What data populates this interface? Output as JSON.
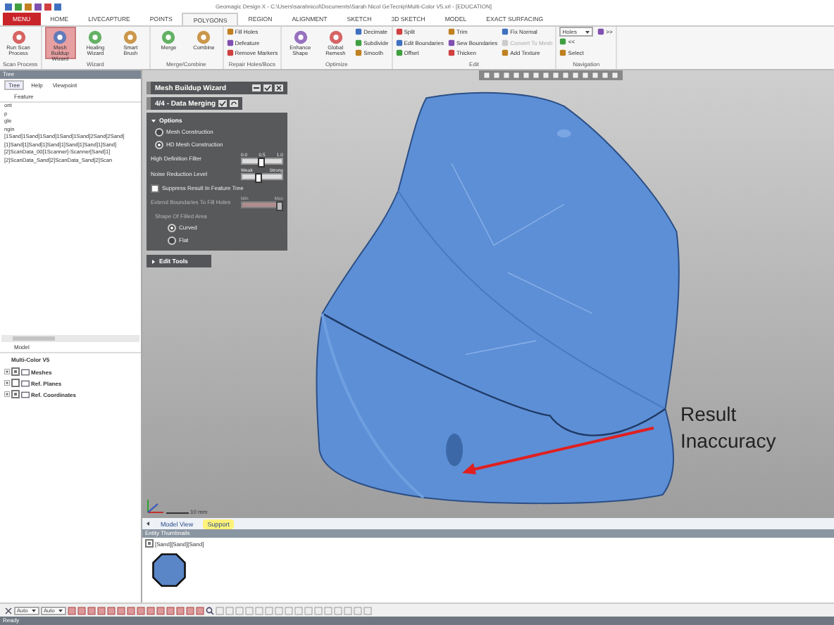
{
  "window": {
    "title": "Geomagic Design X - C:\\Users\\sarahnicol\\Documents\\Sarah Nicol GeTecnip\\Multi-Color V5.xrl - [EDUCATION]"
  },
  "ribbon_tabs": [
    {
      "label": "MENU",
      "kind": "menu",
      "selected": false
    },
    {
      "label": "HOME",
      "kind": "tab",
      "selected": false
    },
    {
      "label": "LIVECAPTURE",
      "kind": "tab",
      "selected": false
    },
    {
      "label": "POINTS",
      "kind": "tab",
      "selected": false
    },
    {
      "label": "POLYGONS",
      "kind": "tab",
      "selected": true
    },
    {
      "label": "REGION",
      "kind": "tab",
      "selected": false
    },
    {
      "label": "ALIGNMENT",
      "kind": "tab",
      "selected": false
    },
    {
      "label": "SKETCH",
      "kind": "tab",
      "selected": false
    },
    {
      "label": "3D SKETCH",
      "kind": "tab",
      "selected": false
    },
    {
      "label": "MODEL",
      "kind": "tab",
      "selected": false
    },
    {
      "label": "EXACT SURFACING",
      "kind": "tab",
      "selected": false
    }
  ],
  "ribbon_groups": [
    {
      "label": "Scan Process",
      "buttons": [
        {
          "kind": "large",
          "label": "Run Scan Process",
          "selected": false
        }
      ]
    },
    {
      "label": "Wizard",
      "buttons": [
        {
          "kind": "large",
          "label": "Mesh Buildup Wizard",
          "selected": true
        },
        {
          "kind": "large",
          "label": "Healing Wizard",
          "selected": false
        },
        {
          "kind": "large",
          "label": "Smart Brush",
          "selected": false
        }
      ]
    },
    {
      "label": "Merge/Combine",
      "buttons": [
        {
          "kind": "large",
          "label": "Merge",
          "selected": false
        },
        {
          "kind": "large",
          "label": "Combine",
          "selected": false
        }
      ]
    },
    {
      "label": "Repair Holes/Bocs",
      "buttons": [
        {
          "kind": "small",
          "label": "Fill Holes",
          "disabled": false
        },
        {
          "kind": "small",
          "label": "Defeature",
          "disabled": false
        },
        {
          "kind": "small",
          "label": "Remove Markers",
          "disabled": false
        }
      ]
    },
    {
      "label": "Optimize",
      "buttons": [
        {
          "kind": "large",
          "label": "Enhance Shape",
          "selected": false
        },
        {
          "kind": "large",
          "label": "Global Remesh",
          "selected": false
        },
        {
          "kind": "small",
          "label": "Decimate",
          "disabled": false
        },
        {
          "kind": "small",
          "label": "Subdivide",
          "disabled": false
        },
        {
          "kind": "small",
          "label": "Smooth",
          "disabled": false
        }
      ]
    },
    {
      "label": "Edit",
      "buttons": [
        {
          "kind": "small",
          "label": "Split",
          "disabled": false
        },
        {
          "kind": "small",
          "label": "Edit Boundaries",
          "disabled": false
        },
        {
          "kind": "small",
          "label": "Offset",
          "disabled": false
        },
        {
          "kind": "small",
          "label": "Trim",
          "disabled": false
        },
        {
          "kind": "small",
          "label": "Sew Boundaries",
          "disabled": false
        },
        {
          "kind": "small",
          "label": "Thicken",
          "disabled": false
        },
        {
          "kind": "small",
          "label": "Fix Normal",
          "disabled": false
        },
        {
          "kind": "small",
          "label": "Convert To Mesh",
          "disabled": true
        },
        {
          "kind": "small",
          "label": "Add Texture",
          "disabled": false
        }
      ]
    },
    {
      "label": "Navigation",
      "buttons": [
        {
          "kind": "dropdown",
          "label": "Holes"
        },
        {
          "kind": "small",
          "label": "<<",
          "disabled": false
        },
        {
          "kind": "small",
          "label": "Select",
          "disabled": false
        },
        {
          "kind": "small",
          "label": ">>",
          "disabled": false
        }
      ]
    }
  ],
  "tree_panel": {
    "title": "Tree",
    "tabs": [
      {
        "label": "Tree",
        "selected": true
      },
      {
        "label": "Help",
        "selected": false
      },
      {
        "label": "Viewpoint",
        "selected": false
      }
    ],
    "column": "Feature",
    "rows": [
      "ont",
      "p",
      "gle",
      "ngin",
      "[1Sand]1Sand]1Sand]1Sand]1Sand]2Sand]2Sand]",
      "[1]Sand]1]Sand]1]Sand]1]Sand]1]Sand]1]Sand]",
      "[2]ScanData_00[1Scanner]-Scanner[Sand]1]",
      "[2]ScanData_Sand]2]ScanData_Sand]2]Scan"
    ]
  },
  "model_panel": {
    "title": "Model",
    "items": [
      {
        "label": "Multi-Color V5",
        "children": [
          {
            "label": "Meshes",
            "checked": true
          },
          {
            "label": "Ref. Planes",
            "checked": false
          },
          {
            "label": "Ref. Coordinates",
            "checked": true
          }
        ]
      }
    ]
  },
  "wizard": {
    "title": "Mesh Buildup Wizard",
    "step": "4/4 - Data Merging",
    "options": {
      "title": "Options",
      "expanded": true,
      "methods": [
        {
          "label": "Mesh Construction",
          "selected": false
        },
        {
          "label": "HD Mesh Construction",
          "selected": true
        }
      ],
      "sliders": [
        {
          "label": "High Definition Filter",
          "ticks": [
            "0.0",
            "0.5",
            "1.0"
          ],
          "level": 0.45
        },
        {
          "label": "Noise Reduction Level",
          "ticks": [
            "Weak",
            "Strong"
          ],
          "level": 0.4
        }
      ],
      "suppress": {
        "label": "Suppress Result In Feature Tree",
        "checked": false
      },
      "extend": {
        "label": "Extend Boundaries To Fill Holes",
        "ticks": [
          "Min",
          "Max"
        ],
        "level": 1,
        "disabled": true
      },
      "shape": {
        "label": "Shape Of Filled Area",
        "choices": [
          {
            "label": "Curved",
            "selected": true
          },
          {
            "label": "Flat",
            "selected": false
          }
        ]
      }
    },
    "edit_tools": {
      "title": "Edit Tools",
      "expanded": false
    }
  },
  "viewport": {
    "scale": "10 mm",
    "annotation": "Result Inaccuracy"
  },
  "view_tabs": [
    {
      "label": "Model View",
      "selected": false
    },
    {
      "label": "Support",
      "selected": true
    }
  ],
  "thumbnails": {
    "title": "Entity Thumbnails",
    "items": [
      {
        "label": "[Sand][Sand][Sand]",
        "checked": true
      }
    ]
  },
  "bottom_toolbar": {
    "dropdowns": [
      "Auto",
      "Auto"
    ]
  },
  "status_bar": "Ready"
}
